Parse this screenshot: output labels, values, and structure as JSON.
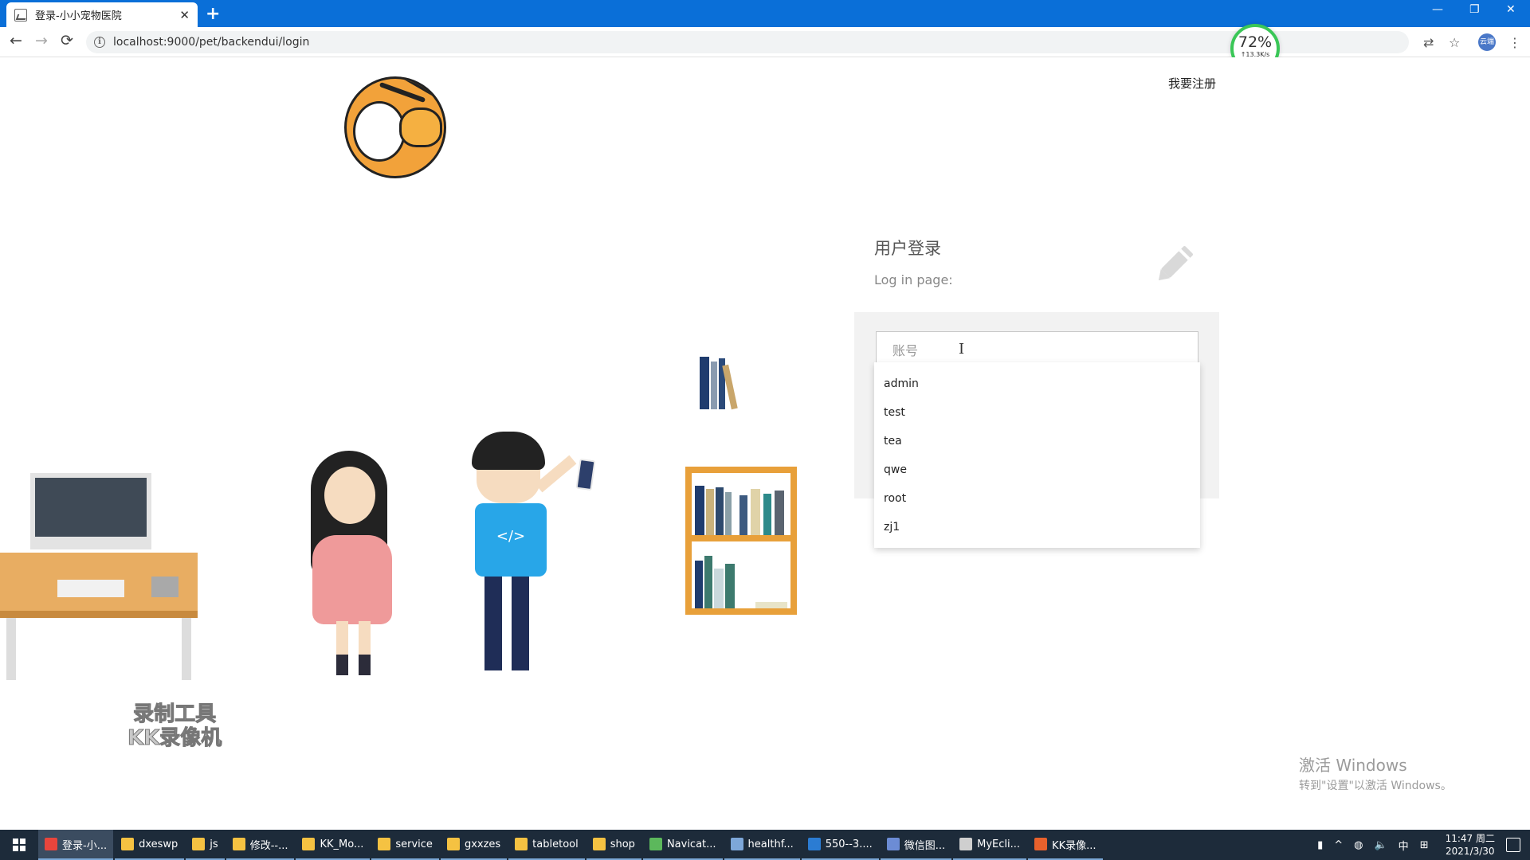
{
  "browser": {
    "tab_title": "登录-小小宠物医院",
    "tab_close": "✕",
    "new_tab": "+",
    "url": "localhost:9000/pet/backendui/login",
    "window_controls": {
      "minimize": "—",
      "restore": "❐",
      "close": "✕"
    },
    "nav": {
      "back": "←",
      "forward": "→",
      "reload": "⟳"
    },
    "profile_label": "云端"
  },
  "speed_badge": {
    "percent": "72%",
    "rate": "↑13.3K/s"
  },
  "page": {
    "register_link": "我要注册",
    "login_title": "用户登录",
    "login_subtitle": "Log in page:",
    "account_placeholder": "账号",
    "autocomplete_options": [
      "admin",
      "test",
      "tea",
      "qwe",
      "root",
      "zj1"
    ],
    "boy_shirt_text": "</>"
  },
  "watermark": {
    "line1": "录制工具",
    "line2": "KK录像机"
  },
  "windows_activation": {
    "title": "激活 Windows",
    "message": "转到\"设置\"以激活 Windows。"
  },
  "taskbar": {
    "items": [
      {
        "label": "登录-小...",
        "icon_color": "#e8453c",
        "active": true
      },
      {
        "label": "dxeswp",
        "icon_color": "#f5c242",
        "active": false
      },
      {
        "label": "js",
        "icon_color": "#f5c242",
        "active": false
      },
      {
        "label": "修改--...",
        "icon_color": "#f5c242",
        "active": false
      },
      {
        "label": "KK_Mo...",
        "icon_color": "#f5c242",
        "active": false
      },
      {
        "label": "service",
        "icon_color": "#f5c242",
        "active": false
      },
      {
        "label": "gxxzes",
        "icon_color": "#f5c242",
        "active": false
      },
      {
        "label": "tabletool",
        "icon_color": "#f5c242",
        "active": false
      },
      {
        "label": "shop",
        "icon_color": "#f5c242",
        "active": false
      },
      {
        "label": "Navicat...",
        "icon_color": "#5cb85c",
        "active": false
      },
      {
        "label": "healthf...",
        "icon_color": "#7da7d9",
        "active": false
      },
      {
        "label": "550--3....",
        "icon_color": "#2b7cd3",
        "active": false
      },
      {
        "label": "微信图...",
        "icon_color": "#6c8cd5",
        "active": false
      },
      {
        "label": "MyEcli...",
        "icon_color": "#cfcfcf",
        "active": false
      },
      {
        "label": "KK录像...",
        "icon_color": "#e8612c",
        "active": false
      }
    ],
    "tray_ime": "中",
    "time": "11:47 周二",
    "date": "2021/3/30"
  },
  "colors": {
    "titlebar": "#0a6fd8",
    "taskbar": "#1d2b3a",
    "login_panel": "#f2f2f2",
    "shelf": "#e8a03a",
    "shirt": "#28a6e8"
  }
}
